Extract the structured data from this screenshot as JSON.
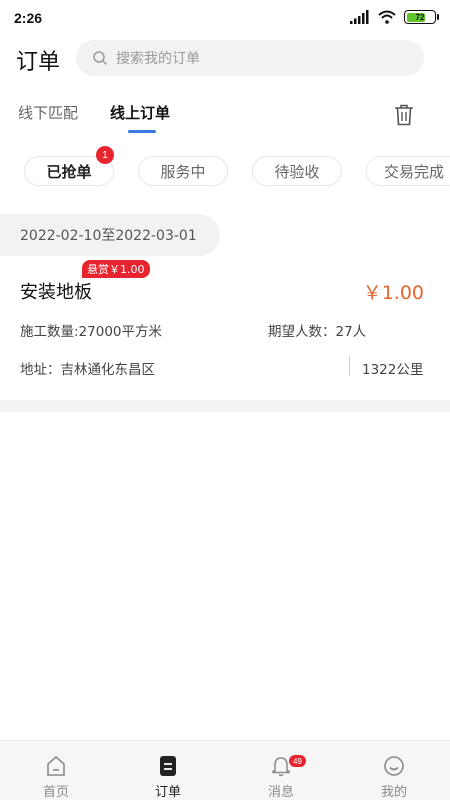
{
  "status_bar": {
    "time": "2:26",
    "battery": 72,
    "icons": [
      "signal-icon",
      "wifi-icon",
      "battery-icon"
    ]
  },
  "header": {
    "title": "订单",
    "search_placeholder": "搜索我的订单"
  },
  "tabs": [
    {
      "label": "线下匹配",
      "active": false
    },
    {
      "label": "线上订单",
      "active": true
    }
  ],
  "accent_color": "#3e7ae5",
  "price_color": "#e0672f",
  "badge_color": "#e8252f",
  "filters": [
    {
      "label": "已抢单",
      "active": true,
      "badge": "1"
    },
    {
      "label": "服务中",
      "active": false
    },
    {
      "label": "待验收",
      "active": false
    },
    {
      "label": "交易完成",
      "active": false
    }
  ],
  "date_range": "2022-02-10至2022-03-01",
  "order": {
    "bounty": "悬赏￥1.00",
    "title": "安装地板",
    "price": "￥1.00",
    "quantity": "施工数量:27000平方米",
    "people": "期望人数：27人",
    "address": "地址：吉林通化东昌区",
    "distance": "1322公里"
  },
  "bottom_nav": [
    {
      "label": "首页",
      "icon": "home-icon",
      "active": false
    },
    {
      "label": "订单",
      "icon": "order-icon",
      "active": true
    },
    {
      "label": "消息",
      "icon": "bell-icon",
      "active": false,
      "badge": "49"
    },
    {
      "label": "我的",
      "icon": "smile-icon",
      "active": false
    }
  ]
}
